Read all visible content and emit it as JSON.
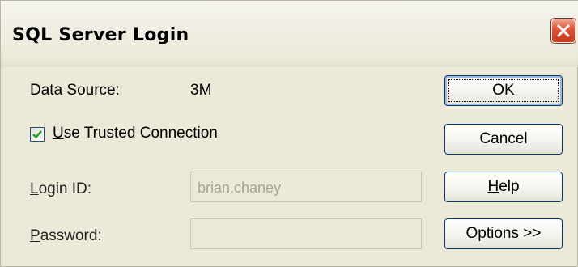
{
  "window": {
    "title": "SQL Server Login",
    "close_icon": "close-icon"
  },
  "form": {
    "data_source_label": "Data Source:",
    "data_source_value": "3M",
    "trusted_connection": {
      "mnemonic": "U",
      "label_rest": "se Trusted Connection",
      "checked": true
    },
    "login_id": {
      "mnemonic": "L",
      "label_rest": "ogin ID:",
      "value": "brian.chaney",
      "enabled": false
    },
    "password": {
      "mnemonic": "P",
      "label_rest": "assword:",
      "value": "",
      "enabled": false
    }
  },
  "buttons": {
    "ok": "OK",
    "cancel": "Cancel",
    "help_mnemonic": "H",
    "help_rest": "elp",
    "options_mnemonic": "O",
    "options_rest": "ptions >>"
  },
  "colors": {
    "dialog_bg": "#ece9d8",
    "button_border": "#003c74",
    "close_button": "#e0553a",
    "disabled_text": "#a6a493"
  }
}
